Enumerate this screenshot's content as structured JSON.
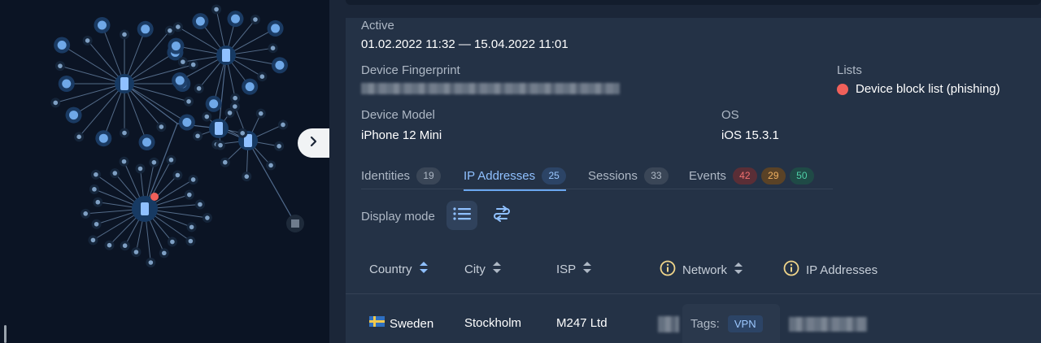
{
  "graph": {
    "description_icon": "network-graph"
  },
  "fields": {
    "active_label": "Active",
    "active_value": "01.02.2022 11:32  —  15.04.2022 11:01",
    "fingerprint_label": "Device Fingerprint",
    "lists_label": "Lists",
    "lists_item": "Device block list (phishing)",
    "lists_item_color": "#f0605a",
    "model_label": "Device Model",
    "model_value": "iPhone 12 Mini",
    "os_label": "OS",
    "os_value": "iOS 15.3.1"
  },
  "tabs": [
    {
      "label": "Identities",
      "count": "19"
    },
    {
      "label": "IP Addresses",
      "count": "25"
    },
    {
      "label": "Sessions",
      "count": "33"
    },
    {
      "label": "Events",
      "counts": [
        "42",
        "29",
        "50"
      ]
    }
  ],
  "display_mode_label": "Display mode",
  "table": {
    "headers": [
      "Country",
      "City",
      "ISP",
      "Network",
      "IP Addresses"
    ],
    "rows": [
      {
        "country": "Sweden",
        "city": "Stockholm",
        "isp": "M247 Ltd",
        "tags_label": "Tags:",
        "tag": "VPN"
      }
    ]
  },
  "colors": {
    "accent": "#6aa7f0",
    "events_red": "#f07070",
    "events_orange": "#f0b060",
    "events_green": "#4fd0a8"
  }
}
